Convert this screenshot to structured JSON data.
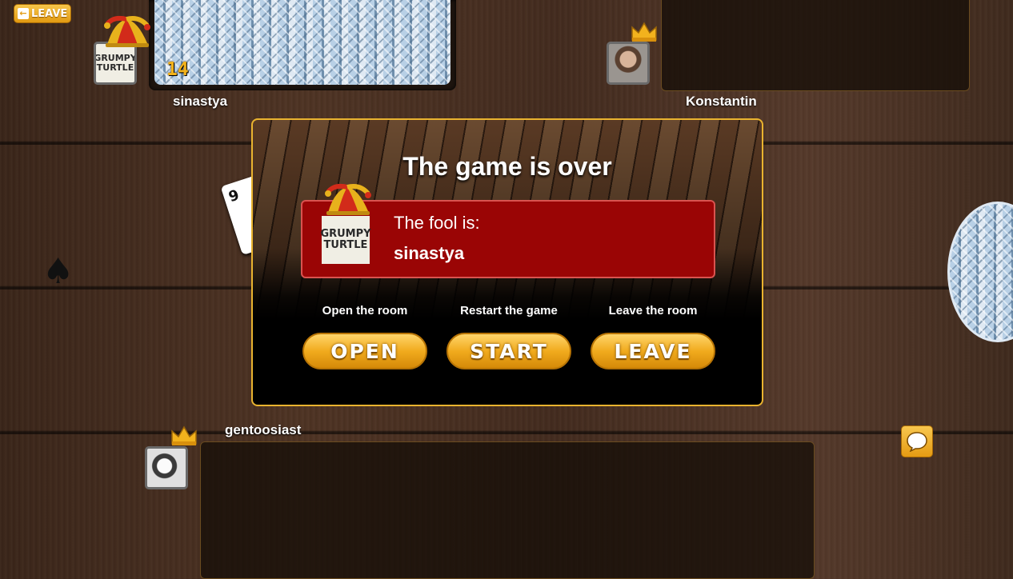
{
  "colors": {
    "accent": "#f1ab1e",
    "fool_box": "#9a0505",
    "modal_border": "#e9b32f"
  },
  "top_bar": {
    "leave_label": "LEAVE",
    "leave_icon": "exit-arrow-icon"
  },
  "players": {
    "top_left": {
      "name": "sinastya",
      "avatar_text": "GRUMPY TURTLE",
      "card_count": "14",
      "badge": "jester-hat-icon"
    },
    "top_right": {
      "name": "Konstantin",
      "badge": "crown-icon"
    },
    "bottom": {
      "name": "gentoosiast",
      "badge": "crown-icon"
    }
  },
  "table": {
    "trump_card_rank": "9",
    "trump_suit_icon": "spade-icon"
  },
  "modal": {
    "title": "The game is over",
    "fool_label": "The fool is:",
    "fool_name": "sinastya",
    "fool_avatar_text": "GRUMPY TURTLE",
    "actions": [
      {
        "label": "Open the room",
        "button": "OPEN"
      },
      {
        "label": "Restart the game",
        "button": "START"
      },
      {
        "label": "Leave the room",
        "button": "LEAVE"
      }
    ]
  },
  "chat": {
    "icon": "chat-bubble-icon"
  }
}
